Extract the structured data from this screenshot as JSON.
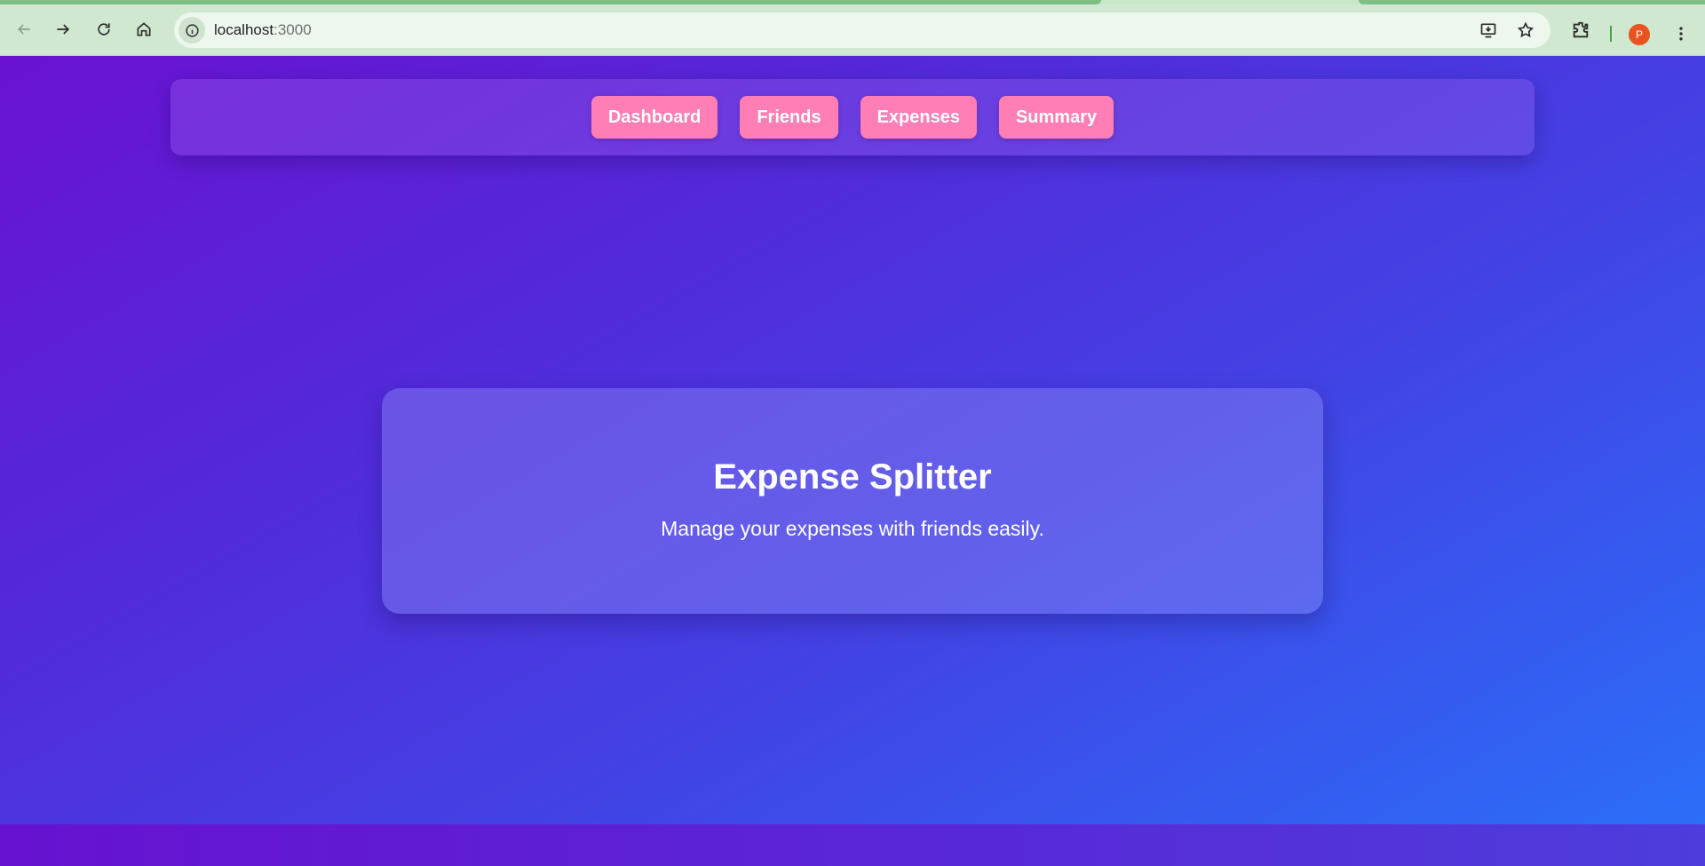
{
  "browser": {
    "url_host": "localhost",
    "url_port": ":3000",
    "profile_initial": "P",
    "icons": [
      "back-icon",
      "forward-icon",
      "reload-icon",
      "home-icon",
      "info-icon",
      "install-app-icon",
      "star-icon",
      "extensions-icon",
      "more-menu-icon"
    ]
  },
  "nav": {
    "items": [
      {
        "label": "Dashboard"
      },
      {
        "label": "Friends"
      },
      {
        "label": "Expenses"
      },
      {
        "label": "Summary"
      }
    ]
  },
  "hero": {
    "title": "Expense Splitter",
    "subtitle": "Manage your expenses with friends easily."
  },
  "colors": {
    "button_bg": "#ff7eb6",
    "gradient_start": "#6a12d2",
    "gradient_end": "#2b6ef8",
    "text": "#ffffff"
  }
}
